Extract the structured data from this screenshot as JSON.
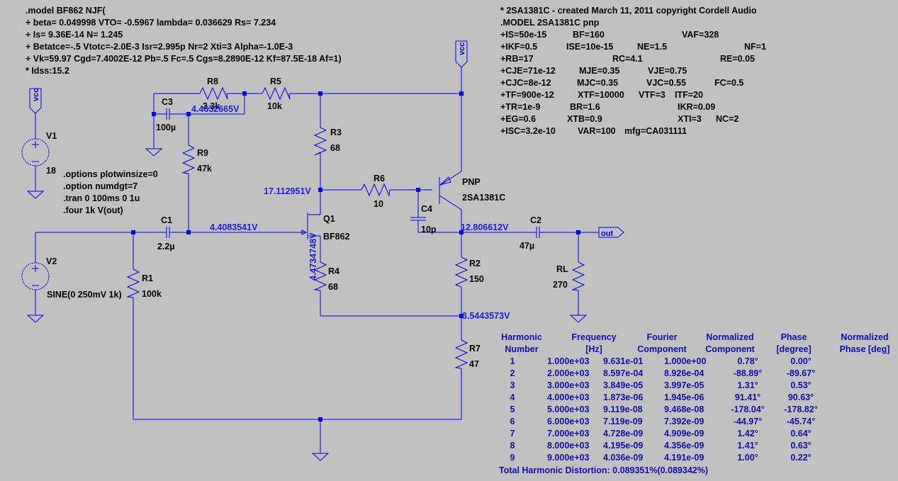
{
  "colors": {
    "background": "#c0c0c0",
    "wire": "#0000f0",
    "node_voltage": "#2020e6",
    "table_text": "#1010b4"
  },
  "models": {
    "bf862": [
      ".model BF862 NJF(",
      "+ beta= 0.049998 VTO= -0.5967 lambda= 0.036629 Rs= 7.234",
      "+ Is= 9.36E-14 N= 1.245",
      "+ Betatce=-.5 Vtotc=-2.0E-3 Isr=2.995p Nr=2 Xti=3 Alpha=-1.0E-3",
      "+ Vk=59.97 Cgd=7.4002E-12 Pb=.5 Fc=.5 Cgs=8.2890E-12 Kf=87.5E-18 Af=1)",
      "* Idss:15.2"
    ],
    "sa1381c": [
      [
        "* 2SA1381C - created March 11, 2011 copyright Cordell Audio"
      ],
      [
        ".MODEL 2SA1381C pnp"
      ],
      [
        "+IS=50e-15",
        "BF=160",
        "VAF=328"
      ],
      [
        "+IKF=0.5",
        "ISE=10e-15",
        "NE=1.5",
        "NF=1"
      ],
      [
        "+RB=17",
        "RC=4.1",
        "RE=0.05"
      ],
      [
        "+CJE=71e-12",
        "MJE=0.35",
        "VJE=0.75"
      ],
      [
        "+CJC=8e-12",
        "MJC=0.35",
        "VJC=0.55",
        "FC=0.5"
      ],
      [
        "+TF=900e-12",
        "XTF=10000",
        "VTF=3",
        "ITF=20"
      ],
      [
        "+TR=1e-9",
        "BR=1.6",
        "IKR=0.09"
      ],
      [
        "+EG=0.6",
        "XTB=0.9",
        "XTI=3",
        "NC=2"
      ],
      [
        "+ISC=3.2e-10",
        "VAR=100",
        "mfg=CA031111"
      ]
    ]
  },
  "directives": [
    ".options plotwinsize=0",
    ".option numdgt=7",
    ".tran 0 100ms 0 1u",
    ".four 1k V(out)"
  ],
  "net_labels": {
    "vcc": "vcc",
    "out": "out"
  },
  "components": {
    "V1": {
      "name": "V1",
      "value": "18"
    },
    "V2": {
      "name": "V2",
      "value": "SINE(0 250mV 1k)"
    },
    "R1": {
      "name": "R1",
      "value": "100k"
    },
    "R2": {
      "name": "R2",
      "value": "150"
    },
    "R3": {
      "name": "R3",
      "value": "68"
    },
    "R4": {
      "name": "R4",
      "value": "68"
    },
    "R5": {
      "name": "R5",
      "value": "10k"
    },
    "R6": {
      "name": "R6",
      "value": "10"
    },
    "R7": {
      "name": "R7",
      "value": "47"
    },
    "R8": {
      "name": "R8",
      "value": "3.3k"
    },
    "R9": {
      "name": "R9",
      "value": "47k"
    },
    "RL": {
      "name": "RL",
      "value": "270"
    },
    "C1": {
      "name": "C1",
      "value": "2.2µ"
    },
    "C2": {
      "name": "C2",
      "value": "47µ"
    },
    "C3": {
      "name": "C3",
      "value": "100µ"
    },
    "C4": {
      "name": "C4",
      "value": "10p"
    },
    "Q1": {
      "name": "Q1",
      "value": "BF862"
    },
    "Q2": {
      "name": "PNP",
      "value": "2SA1381C"
    }
  },
  "node_voltages": {
    "r8_r5": "4.4632665V",
    "gate": "4.4083541V",
    "drain": "17.112951V",
    "collector": "12.806612V",
    "r2_r7": "3.5443573V",
    "source": "4.4734748V"
  },
  "fourier": {
    "headers": [
      [
        "Harmonic",
        "Number"
      ],
      [
        "Frequency",
        "[Hz]"
      ],
      [
        "Fourier",
        "Component"
      ],
      [
        "Normalized",
        "Component"
      ],
      [
        "Phase",
        "[degree]"
      ],
      [
        "Normalized",
        "Phase [deg]"
      ]
    ],
    "rows": [
      [
        "1",
        "1.000e+03",
        "9.631e-01",
        "1.000e+00",
        "0.78°",
        "0.00°"
      ],
      [
        "2",
        "2.000e+03",
        "8.597e-04",
        "8.926e-04",
        "-88.89°",
        "-89.67°"
      ],
      [
        "3",
        "3.000e+03",
        "3.849e-05",
        "3.997e-05",
        "1.31°",
        "0.53°"
      ],
      [
        "4",
        "4.000e+03",
        "1.873e-06",
        "1.945e-06",
        "91.41°",
        "90.63°"
      ],
      [
        "5",
        "5.000e+03",
        "9.119e-08",
        "9.468e-08",
        "-178.04°",
        "-178.82°"
      ],
      [
        "6",
        "6.000e+03",
        "7.119e-09",
        "7.392e-09",
        "-44.97°",
        "-45.74°"
      ],
      [
        "7",
        "7.000e+03",
        "4.728e-09",
        "4.909e-09",
        "1.42°",
        "0.64°"
      ],
      [
        "8",
        "8.000e+03",
        "4.195e-09",
        "4.356e-09",
        "1.41°",
        "0.63°"
      ],
      [
        "9",
        "9.000e+03",
        "4.036e-09",
        "4.191e-09",
        "1.00°",
        "0.22°"
      ]
    ],
    "thd": "Total Harmonic Distortion: 0.089351%(0.089342%)"
  }
}
